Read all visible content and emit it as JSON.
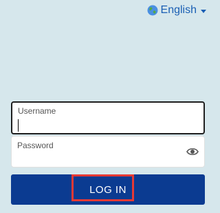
{
  "language": {
    "label": "English",
    "globe_icon": "globe-icon",
    "dropdown_icon": "chevron-down-icon"
  },
  "form": {
    "username_label": "Username",
    "password_label": "Password",
    "password_toggle_icon": "eye-icon",
    "login_button_label": "LOG IN"
  },
  "colors": {
    "background": "#d6e7ec",
    "button": "#0b3b91",
    "link": "#1a5fb4",
    "highlight": "#e53935"
  }
}
